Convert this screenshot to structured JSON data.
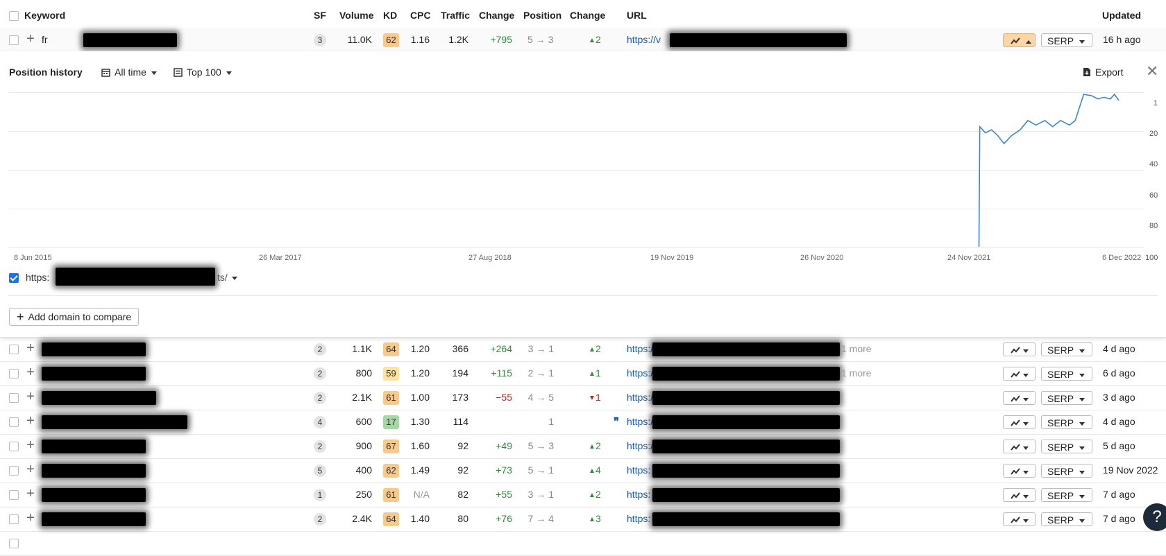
{
  "header": {
    "keyword": "Keyword",
    "sf": "SF",
    "volume": "Volume",
    "kd": "KD",
    "cpc": "CPC",
    "traffic": "Traffic",
    "change": "Change",
    "position": "Position",
    "change2": "Change",
    "url": "URL",
    "updated": "Updated"
  },
  "expanded_row": {
    "kw_prefix": "fr",
    "sf": "3",
    "volume": "11.0K",
    "kd": "62",
    "kd_color": "#f7c98d",
    "cpc": "1.16",
    "traffic": "1.2K",
    "change": "+795",
    "position": "5 → 3",
    "pos_change": "2",
    "url_prefix": "https://v",
    "serp": "SERP",
    "updated": "16 h ago"
  },
  "panel": {
    "title": "Position history",
    "time_filter": "All time",
    "top_filter": "Top 100",
    "export": "Export",
    "legend_url_prefix": "https:",
    "legend_url_suffix": "ts/",
    "add_domain": "Add domain to compare"
  },
  "chart_data": {
    "type": "line",
    "title": "",
    "x_labels": [
      "8 Jun 2015",
      "26 Mar 2017",
      "27 Aug 2018",
      "19 Nov 2019",
      "26 Nov 2020",
      "24 Nov 2021",
      "6 Dec 2022"
    ],
    "y_labels": [
      "1",
      "20",
      "40",
      "60",
      "80",
      "100"
    ],
    "ylim": [
      100,
      1
    ],
    "y_reversed": true,
    "grid": true,
    "series": [
      {
        "color": "#3a86d4",
        "points": [
          [
            "2021-12-20",
            100
          ],
          [
            "2021-12-22",
            22
          ],
          [
            "2022-01-05",
            26
          ],
          [
            "2022-01-20",
            24
          ],
          [
            "2022-02-05",
            28
          ],
          [
            "2022-02-20",
            33
          ],
          [
            "2022-03-10",
            28
          ],
          [
            "2022-04-01",
            24
          ],
          [
            "2022-04-20",
            18
          ],
          [
            "2022-05-10",
            21
          ],
          [
            "2022-06-01",
            18
          ],
          [
            "2022-06-20",
            22
          ],
          [
            "2022-07-10",
            18
          ],
          [
            "2022-08-01",
            21
          ],
          [
            "2022-08-15",
            18
          ],
          [
            "2022-08-25",
            10
          ],
          [
            "2022-09-05",
            1
          ],
          [
            "2022-09-25",
            2
          ],
          [
            "2022-10-10",
            4
          ],
          [
            "2022-10-25",
            3
          ],
          [
            "2022-11-10",
            4
          ],
          [
            "2022-11-20",
            1
          ],
          [
            "2022-12-01",
            5
          ]
        ]
      }
    ]
  },
  "rows": [
    {
      "sf": "2",
      "volume": "1.1K",
      "kd": "64",
      "kd_color": "#f7c98d",
      "cpc": "1.20",
      "cpc_na": false,
      "traffic": "366",
      "change": "+264",
      "change_type": "pos",
      "position": "3 → 1",
      "pos_change": "2",
      "pos_dir": "up",
      "url_prefix": "https://v",
      "more": "1 more",
      "updated": "4 d ago",
      "serp": "SERP",
      "redact_w": 150
    },
    {
      "sf": "2",
      "volume": "800",
      "kd": "59",
      "kd_color": "#fce3a0",
      "cpc": "1.20",
      "cpc_na": false,
      "traffic": "194",
      "change": "+115",
      "change_type": "pos",
      "position": "2 → 1",
      "pos_change": "1",
      "pos_dir": "up",
      "url_prefix": "https://v",
      "more": "1 more",
      "updated": "6 d ago",
      "serp": "SERP",
      "redact_w": 150
    },
    {
      "sf": "2",
      "volume": "2.1K",
      "kd": "61",
      "kd_color": "#f7c98d",
      "cpc": "1.00",
      "cpc_na": false,
      "traffic": "173",
      "change": "−55",
      "change_type": "neg",
      "position": "4 → 5",
      "pos_change": "1",
      "pos_dir": "down",
      "url_prefix": "https://v",
      "more": "",
      "updated": "3 d ago",
      "serp": "SERP",
      "redact_w": 165
    },
    {
      "sf": "4",
      "volume": "600",
      "kd": "17",
      "kd_color": "#a5d8a5",
      "cpc": "1.30",
      "cpc_na": false,
      "traffic": "114",
      "change": "",
      "change_type": "none",
      "position": "1",
      "pos_change": "",
      "pos_dir": "featured",
      "url_prefix": "https://",
      "more": "",
      "updated": "4 d ago",
      "serp": "SERP",
      "redact_w": 210
    },
    {
      "sf": "2",
      "volume": "900",
      "kd": "67",
      "kd_color": "#f7c98d",
      "cpc": "1.60",
      "cpc_na": false,
      "traffic": "92",
      "change": "+49",
      "change_type": "pos",
      "position": "5 → 3",
      "pos_change": "2",
      "pos_dir": "up",
      "url_prefix": "https://",
      "more": "",
      "updated": "5 d ago",
      "serp": "SERP",
      "redact_w": 150
    },
    {
      "sf": "5",
      "volume": "400",
      "kd": "62",
      "kd_color": "#f7c98d",
      "cpc": "1.49",
      "cpc_na": false,
      "traffic": "92",
      "change": "+73",
      "change_type": "pos",
      "position": "5 → 1",
      "pos_change": "4",
      "pos_dir": "up",
      "url_prefix": "https:",
      "more": "",
      "updated": "19 Nov 2022",
      "serp": "SERP",
      "redact_w": 150
    },
    {
      "sf": "1",
      "volume": "250",
      "kd": "61",
      "kd_color": "#f7c98d",
      "cpc": "N/A",
      "cpc_na": true,
      "traffic": "82",
      "change": "+55",
      "change_type": "pos",
      "position": "3 → 1",
      "pos_change": "2",
      "pos_dir": "up",
      "url_prefix": "https:",
      "more": "",
      "updated": "7 d ago",
      "serp": "SERP",
      "redact_w": 150
    },
    {
      "sf": "2",
      "volume": "2.4K",
      "kd": "64",
      "kd_color": "#f7c98d",
      "cpc": "1.40",
      "cpc_na": false,
      "traffic": "80",
      "change": "+76",
      "change_type": "pos",
      "position": "7 → 4",
      "pos_change": "3",
      "pos_dir": "up",
      "url_prefix": "https:",
      "more": "",
      "updated": "7 d ago",
      "serp": "SERP",
      "redact_w": 150
    }
  ],
  "help": "?"
}
